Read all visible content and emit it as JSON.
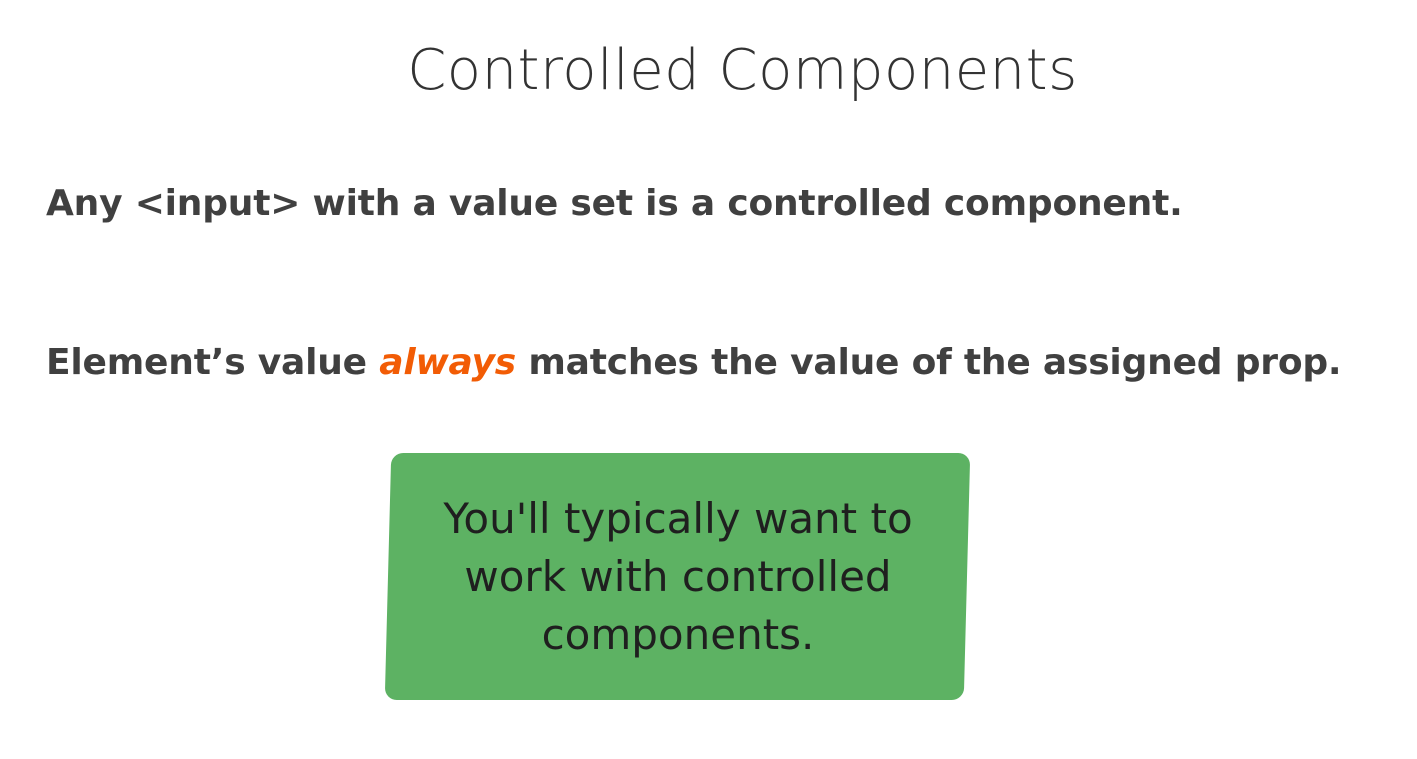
{
  "slide": {
    "title": "Controlled Components",
    "line1": "Any <input> with a value set is a controlled component.",
    "line2_before": "Element’s value ",
    "line2_emphasis": "always",
    "line2_after": " matches the value of the assigned prop.",
    "callout": "You'll typically want to work with controlled components."
  },
  "colors": {
    "emphasis": "#f25c05",
    "callout_background": "#5db263",
    "text": "#404040"
  }
}
